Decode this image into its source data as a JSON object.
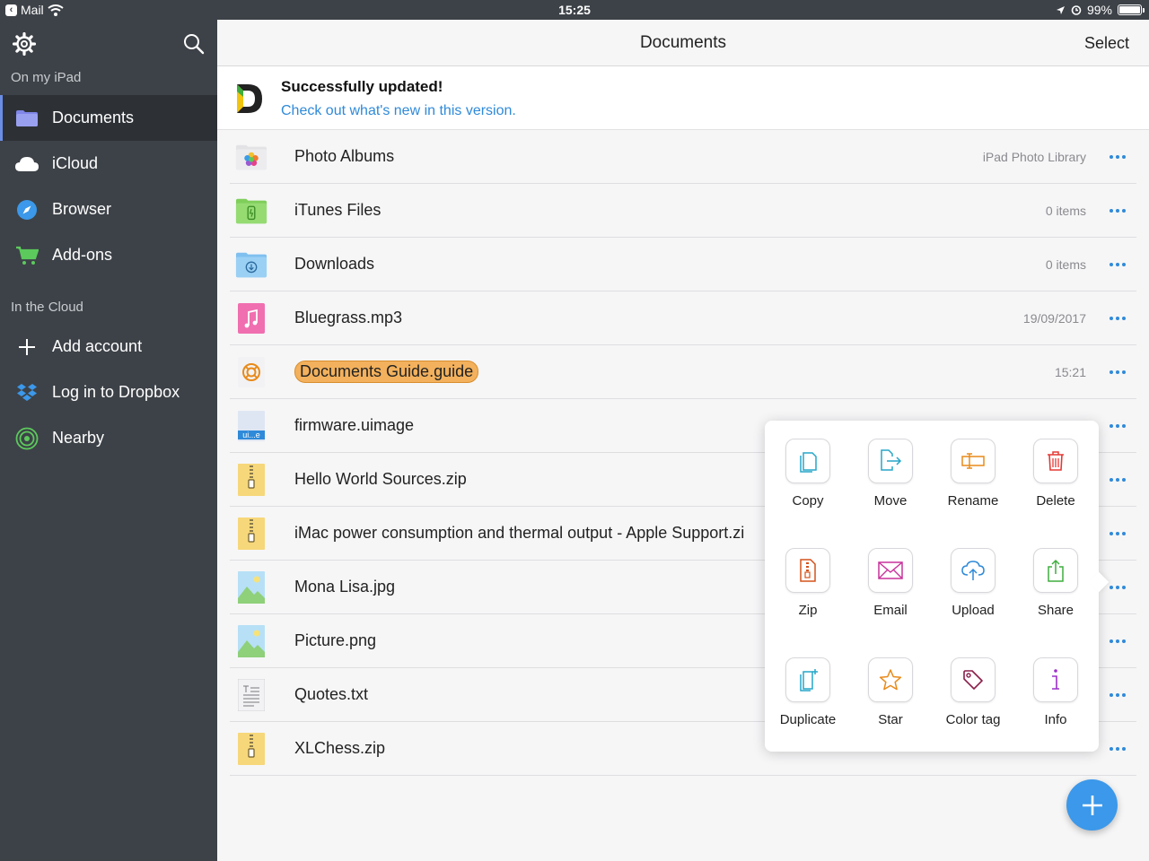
{
  "status_bar": {
    "back_app": "Mail",
    "time": "15:25",
    "battery": "99%",
    "battery_level": 0.99
  },
  "sidebar": {
    "section_local": "On my iPad",
    "local_items": [
      {
        "label": "Documents",
        "icon": "folder-icon",
        "active": true
      },
      {
        "label": "iCloud",
        "icon": "cloud-icon"
      },
      {
        "label": "Browser",
        "icon": "compass-icon"
      },
      {
        "label": "Add-ons",
        "icon": "cart-icon"
      }
    ],
    "section_cloud": "In the Cloud",
    "cloud_items": [
      {
        "label": "Add account",
        "icon": "plus-icon"
      },
      {
        "label": "Log in to Dropbox",
        "icon": "dropbox-icon"
      },
      {
        "label": "Nearby",
        "icon": "nearby-icon"
      }
    ]
  },
  "navbar": {
    "title": "Documents",
    "select_label": "Select"
  },
  "banner": {
    "headline": "Successfully updated!",
    "link": "Check out what's new in this version."
  },
  "files": [
    {
      "name": "Photo Albums",
      "meta": "iPad Photo Library",
      "icon": "photos-folder-icon"
    },
    {
      "name": "iTunes Files",
      "meta": "0 items",
      "icon": "itunes-folder-icon"
    },
    {
      "name": "Downloads",
      "meta": "0 items",
      "icon": "downloads-folder-icon"
    },
    {
      "name": "Bluegrass.mp3",
      "meta": "19/09/2017",
      "icon": "music-file-icon"
    },
    {
      "name": "Documents Guide.guide",
      "meta": "15:21",
      "icon": "guide-icon",
      "tag_color": "#f3b15d"
    },
    {
      "name": "firmware.uimage",
      "meta": "",
      "icon": "uimage-file-icon",
      "icon_text": "ui...e"
    },
    {
      "name": "Hello World Sources.zip",
      "meta": "",
      "icon": "zip-file-icon"
    },
    {
      "name": "iMac power consumption and thermal output - Apple Support.zi",
      "meta": "",
      "icon": "zip-file-icon"
    },
    {
      "name": "Mona Lisa.jpg",
      "meta": "",
      "icon": "image-file-icon"
    },
    {
      "name": "Picture.png",
      "meta": "",
      "icon": "image-file-icon"
    },
    {
      "name": "Quotes.txt",
      "meta": "",
      "icon": "text-file-icon"
    },
    {
      "name": "XLChess.zip",
      "meta": "",
      "icon": "zip-file-icon"
    }
  ],
  "actions": [
    {
      "label": "Copy",
      "icon": "copy-icon",
      "color": "#27a6c9"
    },
    {
      "label": "Move",
      "icon": "move-icon",
      "color": "#27a6c9"
    },
    {
      "label": "Rename",
      "icon": "rename-icon",
      "color": "#e88a1a"
    },
    {
      "label": "Delete",
      "icon": "trash-icon",
      "color": "#e53935"
    },
    {
      "label": "Zip",
      "icon": "zip-icon",
      "color": "#d4531c"
    },
    {
      "label": "Email",
      "icon": "envelope-icon",
      "color": "#c8329b"
    },
    {
      "label": "Upload",
      "icon": "upload-cloud-icon",
      "color": "#2f8ad9"
    },
    {
      "label": "Share",
      "icon": "share-icon",
      "color": "#3fae3f"
    },
    {
      "label": "Duplicate",
      "icon": "duplicate-icon",
      "color": "#27a6c9"
    },
    {
      "label": "Star",
      "icon": "star-icon",
      "color": "#e88a1a"
    },
    {
      "label": "Color tag",
      "icon": "tag-icon",
      "color": "#8a1f4a"
    },
    {
      "label": "Info",
      "icon": "info-icon",
      "color": "#9b30c9"
    }
  ],
  "colors": {
    "accent": "#2f8ad9",
    "sidebar_bg": "#3d4248",
    "fab": "#3b98ea"
  }
}
